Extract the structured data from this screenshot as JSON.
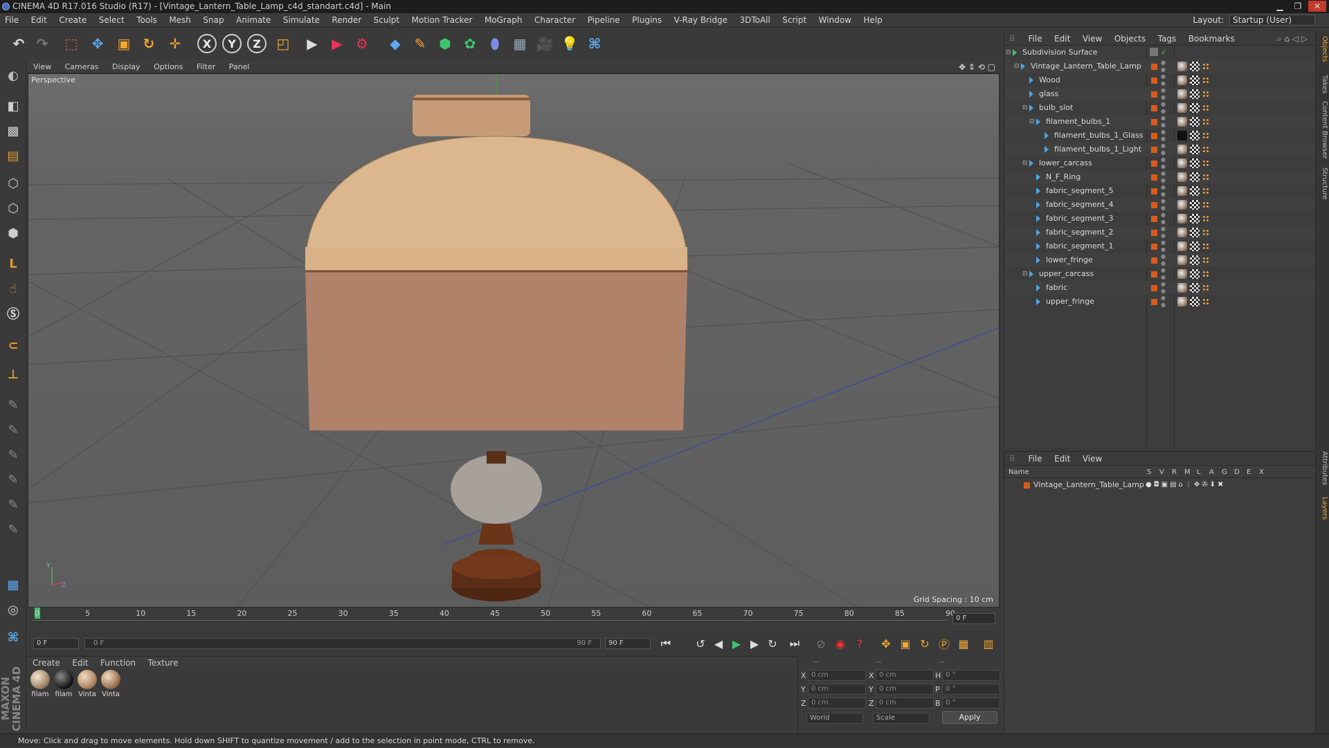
{
  "window": {
    "title": "CINEMA 4D R17.016 Studio (R17) - [Vintage_Lantern_Table_Lamp_c4d_standart.c4d] - Main"
  },
  "menubar": [
    "File",
    "Edit",
    "Create",
    "Select",
    "Tools",
    "Mesh",
    "Snap",
    "Animate",
    "Simulate",
    "Render",
    "Sculpt",
    "Motion Tracker",
    "MoGraph",
    "Character",
    "Pipeline",
    "Plugins",
    "V-Ray Bridge",
    "3DToAll",
    "Script",
    "Window",
    "Help"
  ],
  "layout": {
    "label": "Layout:",
    "value": "Startup (User)"
  },
  "viewport": {
    "menu": [
      "View",
      "Cameras",
      "Display",
      "Options",
      "Filter",
      "Panel"
    ],
    "label": "Perspective",
    "grid_spacing": "Grid Spacing : 10 cm",
    "axis_y": "Y",
    "axis_z": "Z"
  },
  "timeline": {
    "ticks": [
      "0",
      "5",
      "10",
      "15",
      "20",
      "25",
      "30",
      "35",
      "40",
      "45",
      "50",
      "55",
      "60",
      "65",
      "70",
      "75",
      "80",
      "85",
      "90"
    ],
    "current_frame": "0 F",
    "start": "0 F",
    "range_start": "0 F",
    "range_end": "90 F",
    "end": "90 F"
  },
  "materials": {
    "menu": [
      "Create",
      "Edit",
      "Function",
      "Texture"
    ],
    "items": [
      {
        "label": "filam"
      },
      {
        "label": "filam"
      },
      {
        "label": "Vinta"
      },
      {
        "label": "Vinta"
      }
    ]
  },
  "coordinates": {
    "header": [
      "--",
      "--",
      "--"
    ],
    "rows": [
      {
        "l1": "X",
        "v1": "0 cm",
        "l2": "X",
        "v2": "0 cm",
        "l3": "H",
        "v3": "0 °"
      },
      {
        "l1": "Y",
        "v1": "0 cm",
        "l2": "Y",
        "v2": "0 cm",
        "l3": "P",
        "v3": "0 °"
      },
      {
        "l1": "Z",
        "v1": "0 cm",
        "l2": "Z",
        "v2": "0 cm",
        "l3": "B",
        "v3": "0 °"
      }
    ],
    "space": "World",
    "mode": "Scale",
    "apply": "Apply"
  },
  "object_manager": {
    "menu": [
      "File",
      "Edit",
      "View",
      "Objects",
      "Tags",
      "Bookmarks"
    ],
    "objects": [
      {
        "name": "Subdivision Surface"
      },
      {
        "name": "Vintage_Lantern_Table_Lamp"
      },
      {
        "name": "Wood"
      },
      {
        "name": "glass"
      },
      {
        "name": "bulb_slot"
      },
      {
        "name": "filament_bulbs_1"
      },
      {
        "name": "filament_bulbs_1_Glass"
      },
      {
        "name": "filament_bulbs_1_Light"
      },
      {
        "name": "lower_carcass"
      },
      {
        "name": "N_F_Ring"
      },
      {
        "name": "fabric_segment_5"
      },
      {
        "name": "fabric_segment_4"
      },
      {
        "name": "fabric_segment_3"
      },
      {
        "name": "fabric_segment_2"
      },
      {
        "name": "fabric_segment_1"
      },
      {
        "name": "lower_fringe"
      },
      {
        "name": "upper_carcass"
      },
      {
        "name": "fabric"
      },
      {
        "name": "upper_fringe"
      }
    ]
  },
  "layer_manager": {
    "menu": [
      "File",
      "Edit",
      "View"
    ],
    "columns": [
      "Name",
      "S",
      "V",
      "R",
      "M",
      "L",
      "A",
      "G",
      "D",
      "E",
      "X"
    ],
    "layer_name": "Vintage_Lantern_Table_Lamp"
  },
  "right_tabs": [
    "Objects",
    "Takes",
    "Content Browser",
    "Structure",
    "Attributes",
    "Layers"
  ],
  "status": "Move: Click and drag to move elements. Hold down SHIFT to quantize movement / add to the selection in point mode, CTRL to remove.",
  "maxon": "MAXON CINEMA 4D"
}
